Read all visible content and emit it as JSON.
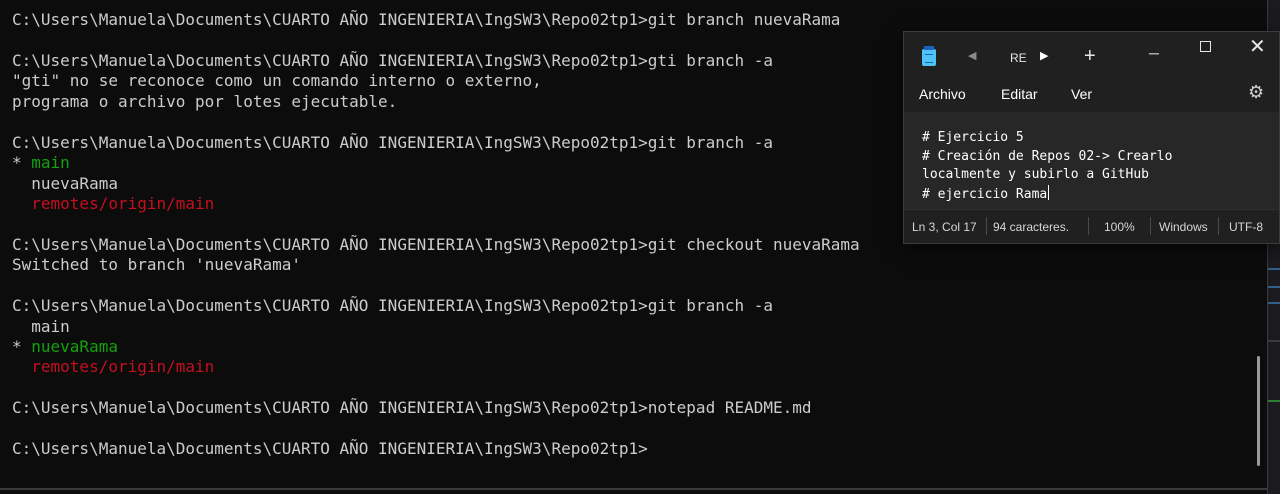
{
  "terminal": {
    "lines": [
      [
        {
          "text": "C:\\Users\\Manuela\\Documents\\CUARTO AÑO INGENIERIA\\IngSW3\\Repo02tp1>git branch nuevaRama"
        }
      ],
      [],
      [
        {
          "text": "C:\\Users\\Manuela\\Documents\\CUARTO AÑO INGENIERIA\\IngSW3\\Repo02tp1>gti branch -a"
        }
      ],
      [
        {
          "text": "\"gti\" no se reconoce como un comando interno o externo,"
        }
      ],
      [
        {
          "text": "programa o archivo por lotes ejecutable."
        }
      ],
      [],
      [
        {
          "text": "C:\\Users\\Manuela\\Documents\\CUARTO AÑO INGENIERIA\\IngSW3\\Repo02tp1>git branch -a"
        }
      ],
      [
        {
          "text": "* "
        },
        {
          "text": "main",
          "color": "green"
        }
      ],
      [
        {
          "text": "  nuevaRama"
        }
      ],
      [
        {
          "text": "  "
        },
        {
          "text": "remotes/origin/main",
          "color": "red"
        }
      ],
      [],
      [
        {
          "text": "C:\\Users\\Manuela\\Documents\\CUARTO AÑO INGENIERIA\\IngSW3\\Repo02tp1>git checkout nuevaRama"
        }
      ],
      [
        {
          "text": "Switched to branch 'nuevaRama'"
        }
      ],
      [],
      [
        {
          "text": "C:\\Users\\Manuela\\Documents\\CUARTO AÑO INGENIERIA\\IngSW3\\Repo02tp1>git branch -a"
        }
      ],
      [
        {
          "text": "  main"
        }
      ],
      [
        {
          "text": "* "
        },
        {
          "text": "nuevaRama",
          "color": "green"
        }
      ],
      [
        {
          "text": "  "
        },
        {
          "text": "remotes/origin/main",
          "color": "red"
        }
      ],
      [],
      [
        {
          "text": "C:\\Users\\Manuela\\Documents\\CUARTO AÑO INGENIERIA\\IngSW3\\Repo02tp1>notepad README.md"
        }
      ],
      [],
      [
        {
          "text": "C:\\Users\\Manuela\\Documents\\CUARTO AÑO INGENIERIA\\IngSW3\\Repo02tp1>"
        }
      ]
    ],
    "colors": {
      "text": "#cccccc",
      "green": "#13a10e",
      "red": "#c50f1f",
      "background": "#0c0c0c"
    }
  },
  "notepad": {
    "app_icon": "notepad-icon",
    "tab_label": "RE",
    "tab_prev_icon": "◀",
    "tab_next_icon": "▶",
    "add_tab_icon": "+",
    "minimize_icon": "─",
    "close_icon": "✕",
    "menu": {
      "archivo": "Archivo",
      "editar": "Editar",
      "ver": "Ver"
    },
    "settings_icon": "⚙",
    "content_lines": [
      "# Ejercicio 5",
      "# Creación de Repos 02-> Crearlo",
      "localmente y subirlo a GitHub",
      "# ejercicio Rama"
    ],
    "status": {
      "position": "Ln 3, Col 17",
      "chars": "94 caracteres.",
      "zoom": "100%",
      "line_ending": "Windows",
      "encoding": "UTF-8"
    }
  }
}
